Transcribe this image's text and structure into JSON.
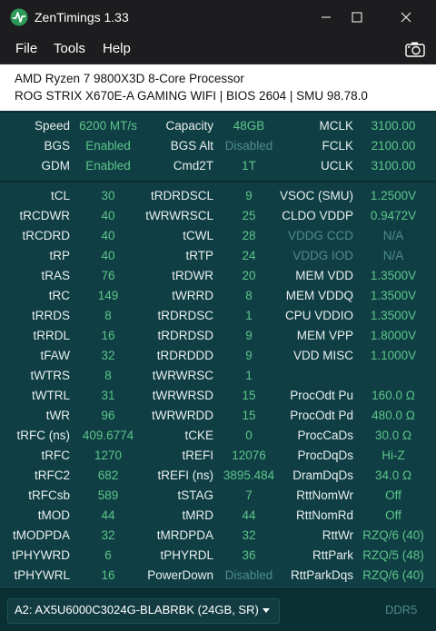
{
  "window": {
    "title": "ZenTimings 1.33"
  },
  "menu": [
    "File",
    "Tools",
    "Help"
  ],
  "system": {
    "cpu": "AMD Ryzen 7 9800X3D 8-Core Processor",
    "board": "ROG STRIX X670E-A GAMING WIFI | BIOS 2604 | SMU 98.78.0"
  },
  "top": [
    [
      [
        "Speed",
        "6200 MT/s"
      ],
      [
        "Capacity",
        "48GB"
      ],
      [
        "MCLK",
        "3100.00"
      ]
    ],
    [
      [
        "BGS",
        "Enabled"
      ],
      [
        "BGS Alt",
        "Disabled"
      ],
      [
        "FCLK",
        "2100.00"
      ]
    ],
    [
      [
        "GDM",
        "Enabled"
      ],
      [
        "Cmd2T",
        "1T"
      ],
      [
        "UCLK",
        "3100.00"
      ]
    ]
  ],
  "timings": [
    [
      [
        "tCL",
        "30"
      ],
      [
        "tRDRDSCL",
        "9"
      ],
      [
        "VSOC (SMU)",
        "1.2500V"
      ]
    ],
    [
      [
        "tRCDWR",
        "40"
      ],
      [
        "tWRWRSCL",
        "25"
      ],
      [
        "CLDO VDDP",
        "0.9472V"
      ]
    ],
    [
      [
        "tRCDRD",
        "40"
      ],
      [
        "tCWL",
        "28"
      ],
      [
        "VDDG CCD",
        "N/A"
      ]
    ],
    [
      [
        "tRP",
        "40"
      ],
      [
        "tRTP",
        "24"
      ],
      [
        "VDDG IOD",
        "N/A"
      ]
    ],
    [
      [
        "tRAS",
        "76"
      ],
      [
        "tRDWR",
        "20"
      ],
      [
        "MEM VDD",
        "1.3500V"
      ]
    ],
    [
      [
        "tRC",
        "149"
      ],
      [
        "tWRRD",
        "8"
      ],
      [
        "MEM VDDQ",
        "1.3500V"
      ]
    ],
    [
      [
        "tRRDS",
        "8"
      ],
      [
        "tRDRDSC",
        "1"
      ],
      [
        "CPU VDDIO",
        "1.3500V"
      ]
    ],
    [
      [
        "tRRDL",
        "16"
      ],
      [
        "tRDRDSD",
        "9"
      ],
      [
        "MEM VPP",
        "1.8000V"
      ]
    ],
    [
      [
        "tFAW",
        "32"
      ],
      [
        "tRDRDDD",
        "9"
      ],
      [
        "VDD MISC",
        "1.1000V"
      ]
    ],
    [
      [
        "tWTRS",
        "8"
      ],
      [
        "tWRWRSC",
        "1"
      ],
      [
        "",
        ""
      ]
    ],
    [
      [
        "tWTRL",
        "31"
      ],
      [
        "tWRWRSD",
        "15"
      ],
      [
        "ProcOdt Pu",
        "160.0 Ω"
      ]
    ],
    [
      [
        "tWR",
        "96"
      ],
      [
        "tWRWRDD",
        "15"
      ],
      [
        "ProcOdt Pd",
        "480.0 Ω"
      ]
    ],
    [
      [
        "tRFC (ns)",
        "409.6774"
      ],
      [
        "tCKE",
        "0"
      ],
      [
        "ProcCaDs",
        "30.0 Ω"
      ]
    ],
    [
      [
        "tRFC",
        "1270"
      ],
      [
        "tREFI",
        "12076"
      ],
      [
        "ProcDqDs",
        "Hi-Z"
      ]
    ],
    [
      [
        "tRFC2",
        "682"
      ],
      [
        "tREFI (ns)",
        "3895.484"
      ],
      [
        "DramDqDs",
        "34.0 Ω"
      ]
    ],
    [
      [
        "tRFCsb",
        "589"
      ],
      [
        "tSTAG",
        "7"
      ],
      [
        "RttNomWr",
        "Off"
      ]
    ],
    [
      [
        "tMOD",
        "44"
      ],
      [
        "tMRD",
        "44"
      ],
      [
        "RttNomRd",
        "Off"
      ]
    ],
    [
      [
        "tMODPDA",
        "32"
      ],
      [
        "tMRDPDA",
        "32"
      ],
      [
        "RttWr",
        "RZQ/6 (40)"
      ]
    ],
    [
      [
        "tPHYWRD",
        "6"
      ],
      [
        "tPHYRDL",
        "36"
      ],
      [
        "RttPark",
        "RZQ/5 (48)"
      ]
    ],
    [
      [
        "tPHYWRL",
        "16"
      ],
      [
        "PowerDown",
        "Disabled"
      ],
      [
        "RttParkDqs",
        "RZQ/6 (40)"
      ]
    ]
  ],
  "disabled_labels": [
    "VDDG CCD",
    "VDDG IOD"
  ],
  "disabled_values": [
    "Disabled",
    "N/A"
  ],
  "bottom": {
    "dimm": "A2: AX5U6000C3024G-BLABRBK (24GB, SR)",
    "memtype": "DDR5"
  },
  "colors": {
    "background": "#0f3f44",
    "value": "#5ec48a",
    "muted": "#4f8a8c"
  }
}
